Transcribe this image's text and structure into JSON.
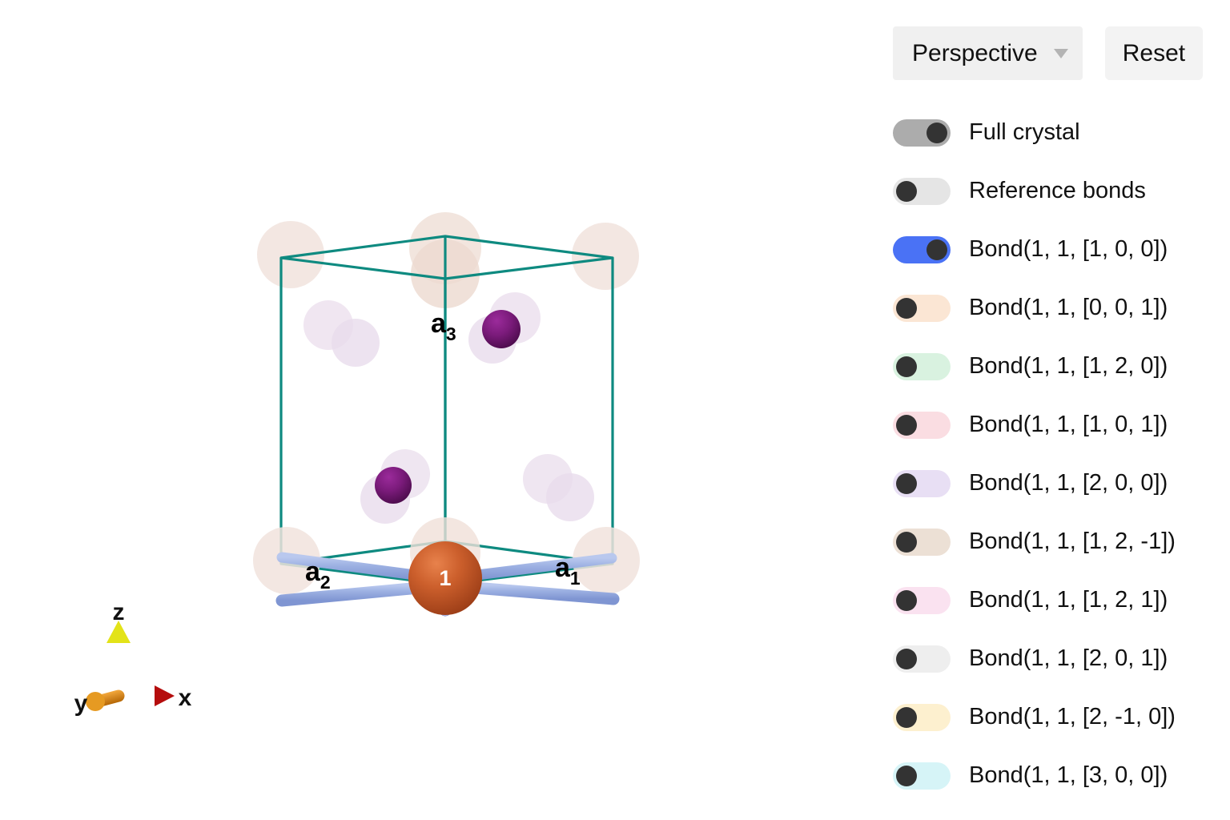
{
  "panel": {
    "projection": {
      "label": "Perspective",
      "chevron_icon": "chevron-down-icon"
    },
    "reset_label": "Reset",
    "toggles": [
      {
        "label": "Full crystal",
        "on": true,
        "track_color": "#acacac"
      },
      {
        "label": "Reference bonds",
        "on": false,
        "track_color": "#e5e5e5"
      },
      {
        "label": "Bond(1, 1, [1, 0, 0])",
        "on": true,
        "track_color": "#4a72f5"
      },
      {
        "label": "Bond(1, 1, [0, 0, 1])",
        "on": false,
        "track_color": "#fbe6d4"
      },
      {
        "label": "Bond(1, 1, [1, 2, 0])",
        "on": false,
        "track_color": "#d9f2e0"
      },
      {
        "label": "Bond(1, 1, [1, 0, 1])",
        "on": false,
        "track_color": "#fadde2"
      },
      {
        "label": "Bond(1, 1, [2, 0, 0])",
        "on": false,
        "track_color": "#e8dff4"
      },
      {
        "label": "Bond(1, 1, [1, 2, -1])",
        "on": false,
        "track_color": "#ece0d5"
      },
      {
        "label": "Bond(1, 1, [1, 2, 1])",
        "on": false,
        "track_color": "#fae2f0"
      },
      {
        "label": "Bond(1, 1, [2, 0, 1])",
        "on": false,
        "track_color": "#eeeeee"
      },
      {
        "label": "Bond(1, 1, [2, -1, 0])",
        "on": false,
        "track_color": "#fdf0cf"
      },
      {
        "label": "Bond(1, 1, [3, 0, 0])",
        "on": false,
        "track_color": "#d6f4f7"
      }
    ]
  },
  "viewer": {
    "lattice_labels": {
      "a1": {
        "base": "a",
        "sub": "1"
      },
      "a2": {
        "base": "a",
        "sub": "2"
      },
      "a3": {
        "base": "a",
        "sub": "3"
      }
    },
    "center_atom_label": "1",
    "axes": {
      "x_label": "x",
      "y_label": "y",
      "z_label": "z",
      "x_color": "#d81111",
      "y_color": "#e08a16",
      "z_color": "#e3e318"
    },
    "colors": {
      "cell_edge": "#0e8a80",
      "center_atom": "#c2562a",
      "purple_atom": "#7b1b7b",
      "ghost_peach": "#f1e3dd",
      "ghost_lavender": "#ece0ee",
      "bond_rod": "#9cb0e2",
      "bond_rod_dark": "#5a5fb5"
    }
  }
}
